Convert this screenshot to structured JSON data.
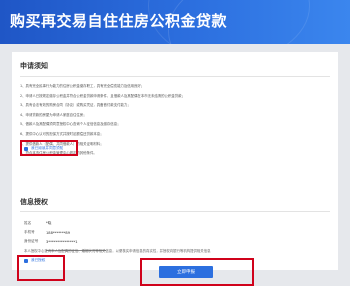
{
  "header": {
    "title": "购买再交易自住住房公积金贷款"
  },
  "notice": {
    "title": "申请须知",
    "items": [
      "1、具有完全民事行为能力的住房公积金缴存职工，具有完全偿债能力及信用良好；",
      "2、申请人已按规定缴存公积金并符合公积金贷款申请条件，且借款人及其配偶在本市无未结清的公积金贷款；",
      "3、具有合法有效的购房合同（协议）或购买凭证，具备首付款支付能力；",
      "4、申请贷款的房屋为申请人家庭自住住房；",
      "5、借款人及其配偶须同意授权中心查询个人征信信息及缴存信息；",
      "6、提供中心认可的担保方式并按时足额偿还贷款本息；",
      "7、提供借款人（配偶、共同借款人）的相关证明材料；",
      "8、符合本市住房公积金管理中心规定的其他条件。"
    ],
    "agree_label": "我已阅读并同意须知"
  },
  "info": {
    "title": "信息授权",
    "rows": [
      {
        "label": "姓名",
        "value": "*晓"
      },
      {
        "label": "手机号",
        "value": "188*******89"
      },
      {
        "label": "身份证号",
        "value": "3***************1"
      },
      {
        "label": "",
        "value": ""
      }
    ],
    "auth_text": "本人授权中心查询本人及配偶的征信、婚姻状况等相关信息，以便核实申请信息的真实性，并授权向银行等机构提供相关信息",
    "agree_label": "我已授权"
  },
  "submit_label": "立即申报",
  "colors": {
    "primary": "#2c6fdf",
    "highlight": "#d0021b"
  }
}
